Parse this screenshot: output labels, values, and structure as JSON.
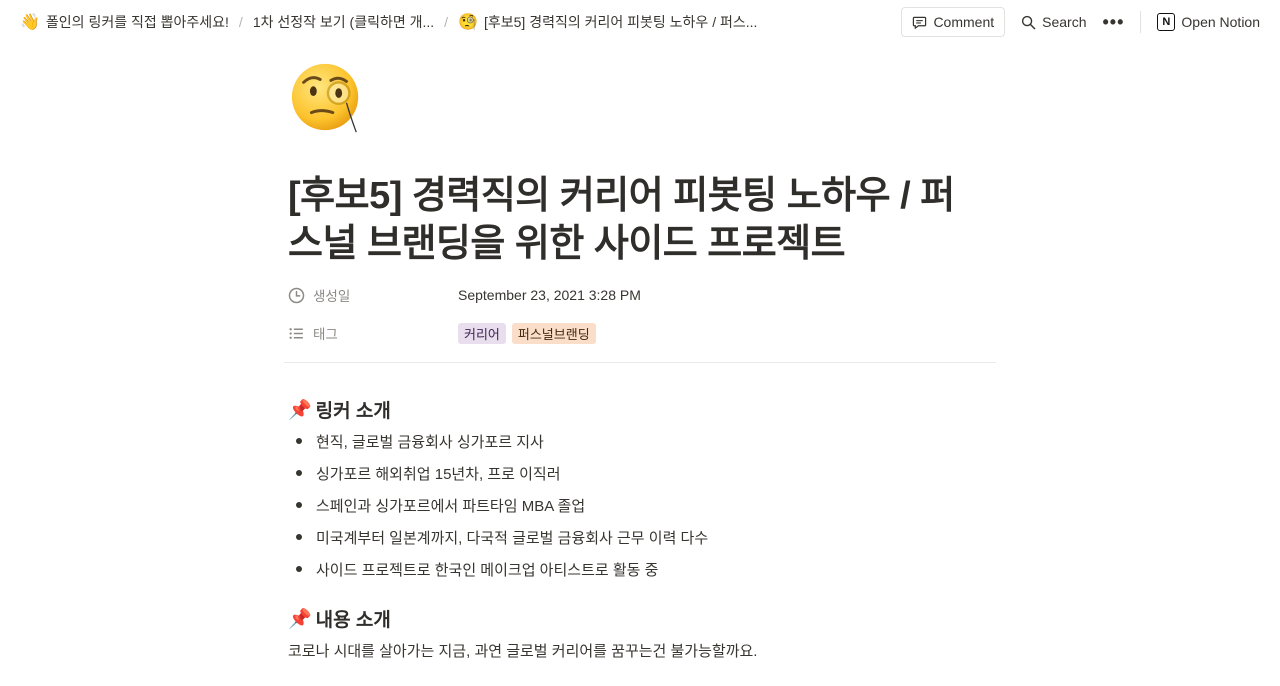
{
  "breadcrumb": [
    {
      "emoji": "👋",
      "label": "폴인의 링커를 직접 뽑아주세요!"
    },
    {
      "emoji": "",
      "label": "1차 선정작 보기 (클릭하면 개..."
    },
    {
      "emoji": "🧐",
      "label": "[후보5] 경력직의 커리어 피봇팅 노하우 / 퍼스..."
    }
  ],
  "header": {
    "comment_label": "Comment",
    "search_label": "Search",
    "more_label": "•••",
    "open_notion_label": "Open Notion"
  },
  "page": {
    "icon": "face-with-monocle-icon",
    "title": "[후보5] 경력직의 커리어 피봇팅 노하우 / 퍼스널 브랜딩을 위한 사이드 프로젝트",
    "properties": {
      "created": {
        "name": "생성일",
        "value": "September 23, 2021 3:28 PM"
      },
      "tags": {
        "name": "태그",
        "values": [
          {
            "label": "커리어",
            "bg": "#e8deee",
            "color": "#412454"
          },
          {
            "label": "퍼스널브랜딩",
            "bg": "#fadec9",
            "color": "#49290e"
          }
        ]
      }
    },
    "section1": {
      "emoji": "📌",
      "heading": "링커 소개",
      "items": [
        "현직, 글로벌 금융회사 싱가포르 지사",
        "싱가포르 해외취업 15년차, 프로 이직러",
        "스페인과 싱가포르에서 파트타임 MBA 졸업",
        "미국계부터 일본계까지, 다국적 글로벌 금융회사 근무 이력 다수",
        "사이드 프로젝트로 한국인 메이크업 아티스트로 활동 중"
      ]
    },
    "section2": {
      "emoji": "📌",
      "heading": "내용 소개",
      "text": "코로나 시대를 살아가는 지금, 과연 글로벌 커리어를 꿈꾸는건 불가능할까요."
    }
  }
}
